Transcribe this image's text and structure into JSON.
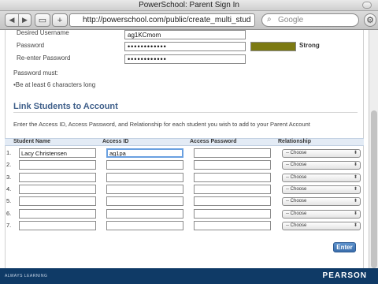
{
  "window": {
    "title": "PowerSchool: Parent Sign In"
  },
  "toolbar": {
    "url": "http://powerschool.com/public/create_multi_stud",
    "search_placeholder": "Google",
    "back_icon": "back-arrow-icon",
    "forward_icon": "forward-arrow-icon"
  },
  "account": {
    "username_label": "Desired Username",
    "username_value": "ag1KCmom",
    "password_label": "Password",
    "password_value": "••••••••••••",
    "reenter_label": "Re-enter Password",
    "reenter_value": "••••••••••••",
    "strength_label": "Strong",
    "strength_fraction": 1.0,
    "strength_color": "#7c7a12",
    "rules_heading": "Password must:",
    "rules": [
      "•Be at least 6 characters long"
    ]
  },
  "link_section": {
    "title": "Link Students to Account",
    "intro": "Enter the Access ID, Access Password, and Relationship for each student you wish to add to your Parent Account",
    "headers": [
      "Student Name",
      "Access ID",
      "Access Password",
      "Relationship"
    ],
    "rows": [
      {
        "num": "1.",
        "student": "Lacy Christensen",
        "access_id": "ag1pa",
        "password": "",
        "relationship": "-- Choose"
      },
      {
        "num": "2.",
        "student": "",
        "access_id": "",
        "password": "",
        "relationship": "-- Choose"
      },
      {
        "num": "3.",
        "student": "",
        "access_id": "",
        "password": "",
        "relationship": "-- Choose"
      },
      {
        "num": "4.",
        "student": "",
        "access_id": "",
        "password": "",
        "relationship": "-- Choose"
      },
      {
        "num": "5.",
        "student": "",
        "access_id": "",
        "password": "",
        "relationship": "-- Choose"
      },
      {
        "num": "6.",
        "student": "",
        "access_id": "",
        "password": "",
        "relationship": "-- Choose"
      },
      {
        "num": "7.",
        "student": "",
        "access_id": "",
        "password": "",
        "relationship": "-- Choose"
      }
    ],
    "enter_label": "Enter"
  },
  "footer": {
    "tagline": "ALWAYS LEARNING",
    "brand": "PEARSON"
  },
  "colors": {
    "accent": "#3f5f8a",
    "footer": "#0f3a66",
    "button": "#3a6dab"
  }
}
